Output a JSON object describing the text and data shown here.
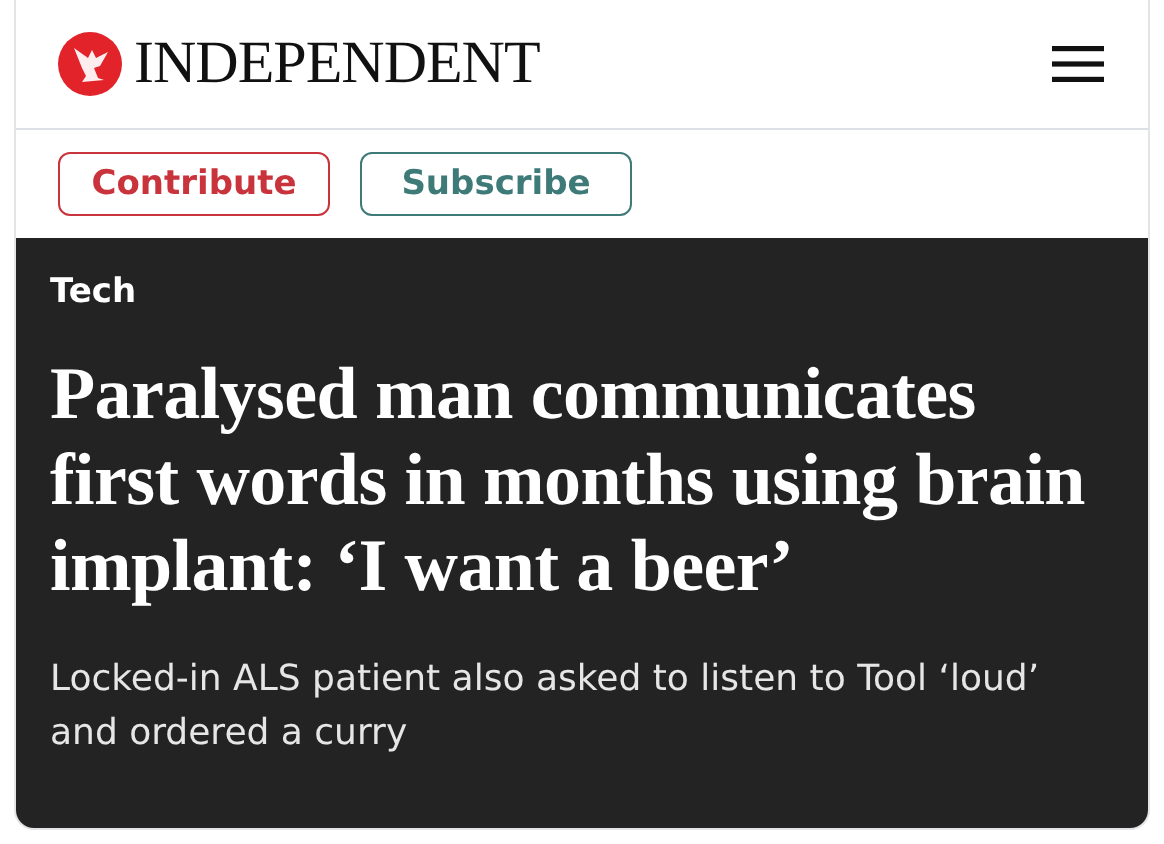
{
  "header": {
    "logo_text": "INDEPENDENT"
  },
  "actions": [
    {
      "label": "Contribute",
      "kind": "contribute"
    },
    {
      "label": "Subscribe",
      "kind": "subscribe"
    }
  ],
  "article": {
    "section": "Tech",
    "headline": "Paralysed man communicates first words in months using brain implant: ‘I want a beer’",
    "standfirst": "Locked-in ALS patient also asked to listen to Tool ‘loud’ and ordered a curry"
  }
}
